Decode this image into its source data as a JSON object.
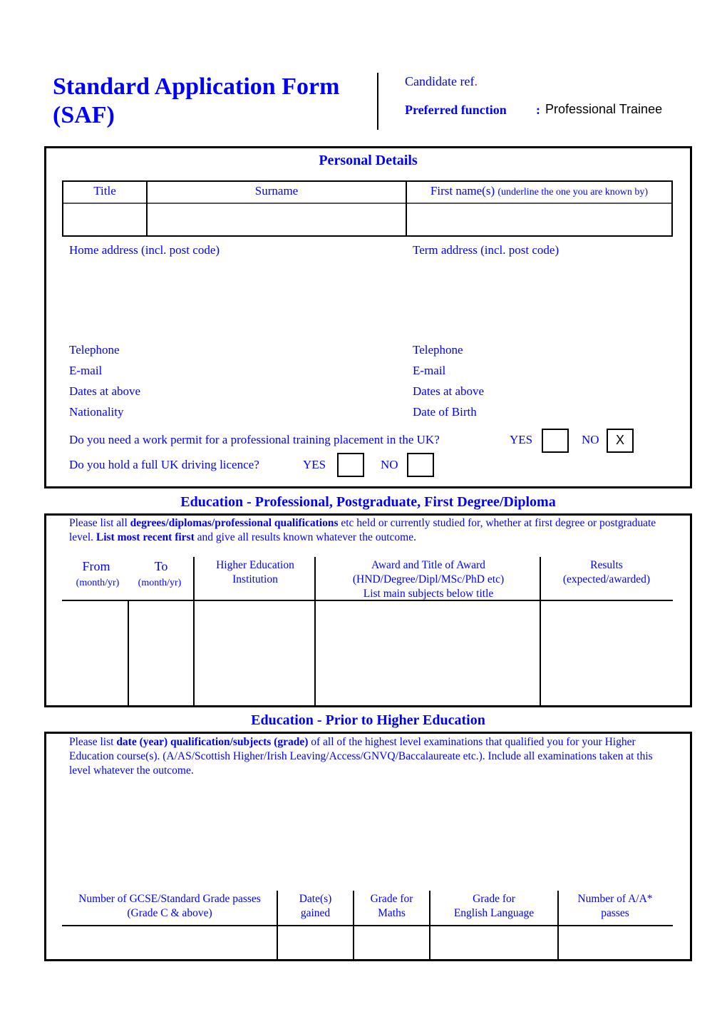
{
  "header": {
    "title_line1": "Standard Application Form",
    "title_line2": "(SAF)",
    "candidate_ref_label": "Candidate ref",
    "candidate_ref_dot": ".",
    "preferred_function_label": "Preferred function",
    "preferred_function_colon": ":",
    "preferred_function_value": "Professional Trainee"
  },
  "personal_details": {
    "section_title": "Personal Details",
    "name_table": {
      "columns": [
        {
          "label": "Title",
          "note": ""
        },
        {
          "label": "Surname",
          "note": ""
        },
        {
          "label": "First name(s)",
          "note": "(underline the one you are known by)"
        }
      ],
      "values": [
        "",
        "",
        ""
      ]
    },
    "home_address_label": "Home address (incl. post code)",
    "term_address_label": "Term address (incl. post code)",
    "left_fields": [
      "Telephone",
      "E-mail",
      "Dates at above",
      "Nationality"
    ],
    "right_fields": [
      "Telephone",
      "E-mail",
      "Dates at above",
      "Date of Birth"
    ],
    "work_permit": {
      "question": "Do you need a work permit for a professional training placement in the UK?",
      "yes_label": "YES",
      "no_label": "NO",
      "yes_value": "",
      "no_value": "X"
    },
    "driving_licence": {
      "question": "Do you hold a full UK driving licence?",
      "yes_label": "YES",
      "no_label": "NO",
      "yes_value": "",
      "no_value": ""
    }
  },
  "education_higher": {
    "section_title": "Education - Professional, Postgraduate, First Degree/Diploma",
    "instructions": {
      "part1": "Please list all ",
      "bold1": "degrees/diplomas/professional qualifications",
      "part2": " etc held or currently studied for, whether at first degree or postgraduate level.  ",
      "bold2": "List most recent first",
      "part3": " and give all results known whatever the outcome."
    },
    "columns": [
      {
        "line1": "From",
        "line2": "(month/yr)",
        "line3": ""
      },
      {
        "line1": "To",
        "line2": "(month/yr)",
        "line3": ""
      },
      {
        "line1": "Higher Education",
        "line2": "Institution",
        "line3": ""
      },
      {
        "line1": "Award and Title of Award",
        "line2": "(HND/Degree/Dipl/MSc/PhD etc)",
        "line3": "List main subjects below title"
      },
      {
        "line1": "Results",
        "line2": "(expected/awarded)",
        "line3": ""
      }
    ]
  },
  "education_prior": {
    "section_title": "Education - Prior to Higher Education",
    "instructions": {
      "part1": "Please list ",
      "bold1": "date (year) qualification/subjects (grade)",
      "part2": " of all of the highest level examinations that qualified you for your Higher Education course(s).  (A/AS/Scottish Higher/Irish Leaving/Access/GNVQ/Baccalaureate etc.).  Include all examinations taken at this level whatever the outcome."
    },
    "columns": [
      {
        "line1": "Number of GCSE/Standard Grade passes",
        "line2": "(Grade C & above)"
      },
      {
        "line1": "Date(s)",
        "line2": "gained"
      },
      {
        "line1": "Grade for",
        "line2": "Maths"
      },
      {
        "line1": "Grade for",
        "line2": "English Language"
      },
      {
        "line1": "Number of A/A*",
        "line2": "passes"
      }
    ],
    "values": [
      "",
      "",
      "",
      "",
      ""
    ]
  }
}
